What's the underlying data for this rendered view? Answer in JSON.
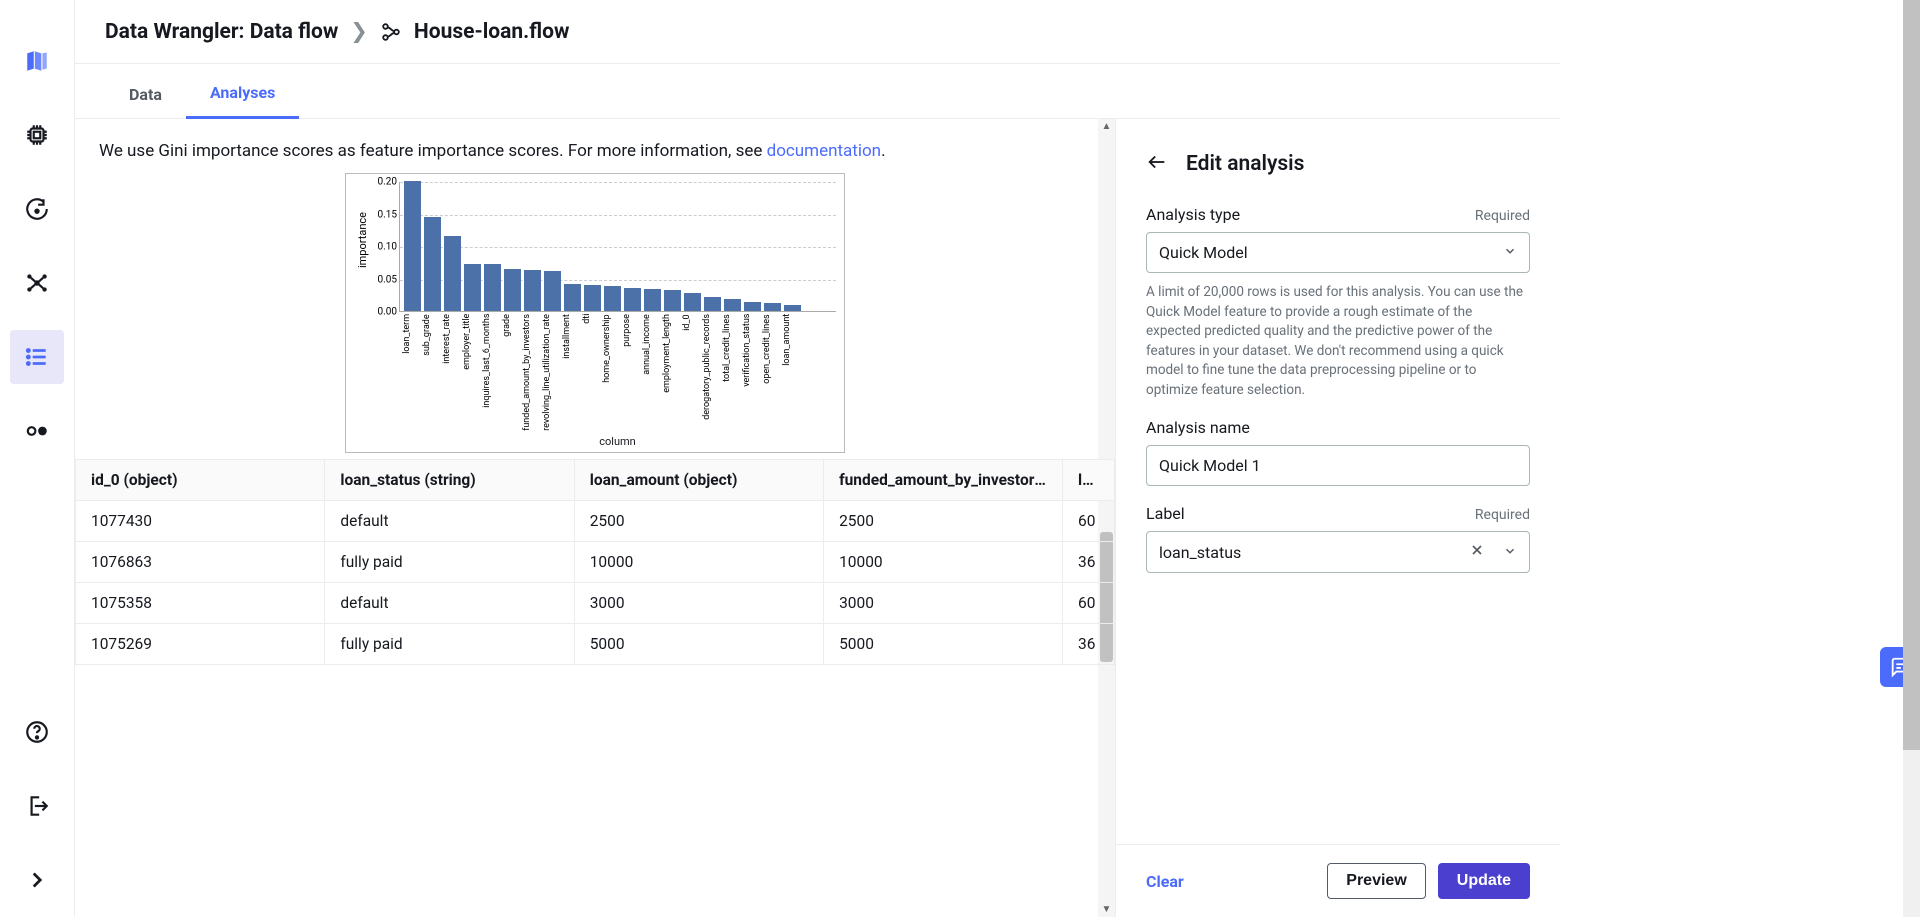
{
  "breadcrumb": {
    "root": "Data Wrangler: Data flow",
    "file": "House-loan.flow"
  },
  "tabs": [
    "Data",
    "Analyses"
  ],
  "description": {
    "text_prefix": "We use Gini importance scores as feature importance scores. For more information, see ",
    "link": "documentation",
    "suffix": "."
  },
  "chart_data": {
    "type": "bar",
    "ylabel": "importance",
    "xlabel": "column",
    "ylim": [
      0.0,
      0.2
    ],
    "y_ticks": [
      0.0,
      0.05,
      0.1,
      0.15,
      0.2
    ],
    "categories": [
      "loan_term",
      "sub_grade",
      "interest_rate",
      "employer_title",
      "inquires_last_6_months",
      "grade",
      "funded_amount_by_investors",
      "revolving_line_utilization_rate",
      "installment",
      "dti",
      "home_ownership",
      "purpose",
      "annual_income",
      "employment_length",
      "id_0",
      "derogatory_public_records",
      "total_credit_lines",
      "verification_status",
      "open_credit_lines",
      "loan_amount"
    ],
    "values": [
      0.2,
      0.145,
      0.115,
      0.073,
      0.072,
      0.065,
      0.063,
      0.062,
      0.042,
      0.04,
      0.038,
      0.036,
      0.034,
      0.033,
      0.027,
      0.022,
      0.018,
      0.014,
      0.012,
      0.01
    ]
  },
  "table": {
    "columns": [
      {
        "name": "id_0",
        "type": "object"
      },
      {
        "name": "loan_status",
        "type": "string"
      },
      {
        "name": "loan_amount",
        "type": "object"
      },
      {
        "name": "funded_amount_by_investors",
        "type": "",
        "truncated": true
      },
      {
        "name": "loan_",
        "type": "",
        "cut": true
      }
    ],
    "rows": [
      {
        "id_0": "1077430",
        "loan_status": "default",
        "loan_amount": "2500",
        "funded": "2500",
        "loan_": "60"
      },
      {
        "id_0": "1076863",
        "loan_status": "fully paid",
        "loan_amount": "10000",
        "funded": "10000",
        "loan_": "36"
      },
      {
        "id_0": "1075358",
        "loan_status": "default",
        "loan_amount": "3000",
        "funded": "3000",
        "loan_": "60"
      },
      {
        "id_0": "1075269",
        "loan_status": "fully paid",
        "loan_amount": "5000",
        "funded": "5000",
        "loan_": "36"
      }
    ]
  },
  "panel": {
    "title": "Edit analysis",
    "fields": {
      "analysis_type": {
        "label": "Analysis type",
        "required": "Required",
        "value": "Quick Model",
        "desc": "A limit of 20,000 rows is used for this analysis. You can use the Quick Model feature to provide a rough estimate of the expected predicted quality and the predictive power of the features in your dataset. We don't recommend using a quick model to fine tune the data preprocessing pipeline or to optimize feature selection."
      },
      "analysis_name": {
        "label": "Analysis name",
        "value": "Quick Model 1"
      },
      "label": {
        "label": "Label",
        "required": "Required",
        "value": "loan_status"
      }
    },
    "footer": {
      "clear": "Clear",
      "preview": "Preview",
      "update": "Update"
    }
  }
}
